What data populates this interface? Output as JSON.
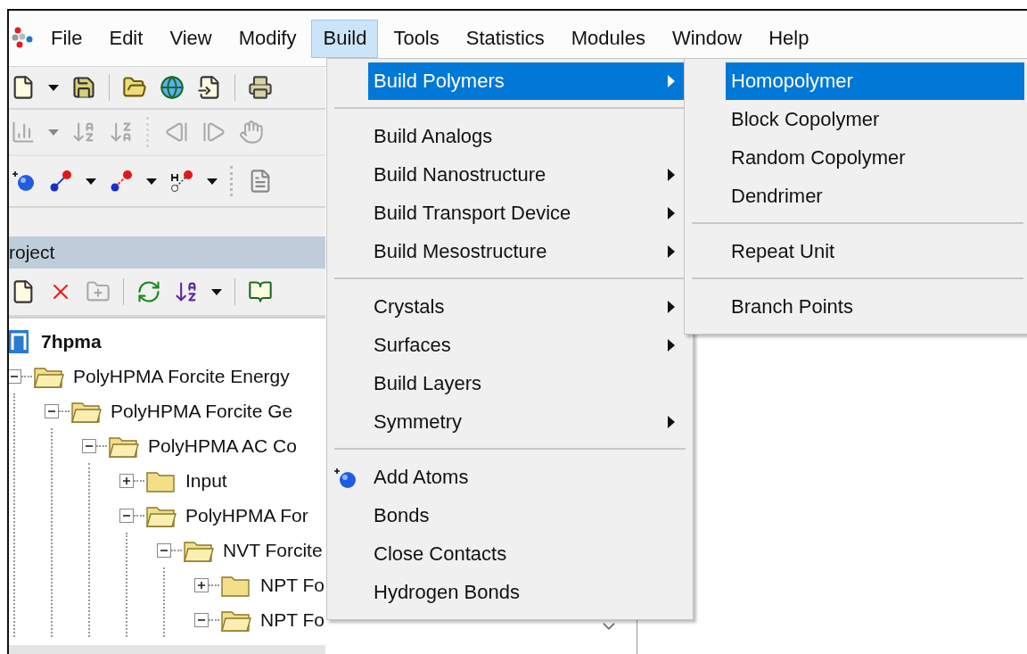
{
  "menu_bar": [
    {
      "label": "File",
      "selected": false
    },
    {
      "label": "Edit",
      "selected": false
    },
    {
      "label": "View",
      "selected": false
    },
    {
      "label": "Modify",
      "selected": false
    },
    {
      "label": "Build",
      "selected": true
    },
    {
      "label": "Tools",
      "selected": false
    },
    {
      "label": "Statistics",
      "selected": false
    },
    {
      "label": "Modules",
      "selected": false
    },
    {
      "label": "Window",
      "selected": false
    },
    {
      "label": "Help",
      "selected": false
    }
  ],
  "toolbars": [
    {
      "disabled": false
    },
    {
      "disabled": true
    },
    {
      "disabled": false
    }
  ],
  "project_panel": {
    "title": "roject",
    "tree": {
      "label": "7hpma",
      "children": [
        {
          "label": "PolyHPMA Forcite Energy",
          "expanded": true,
          "children": [
            {
              "label": "PolyHPMA Forcite Ge",
              "expanded": true,
              "children": [
                {
                  "label": "PolyHPMA AC Co",
                  "expanded": true,
                  "children": [
                    {
                      "label": "Input",
                      "expanded": false
                    },
                    {
                      "label": "PolyHPMA For",
                      "expanded": true,
                      "children": [
                        {
                          "label": "NVT Forcite",
                          "expanded": true,
                          "children": [
                            {
                              "label": "NPT Fo",
                              "expanded": false
                            },
                            {
                              "label": "NPT Fo",
                              "expanded": true
                            }
                          ]
                        }
                      ]
                    }
                  ]
                }
              ]
            }
          ]
        }
      ]
    }
  },
  "build_menu": {
    "items": [
      {
        "kind": "item",
        "label": "Build Polymers",
        "submenu": true,
        "selected": true
      },
      {
        "kind": "separator"
      },
      {
        "kind": "item",
        "label": "Build Analogs",
        "submenu": false,
        "selected": false
      },
      {
        "kind": "item",
        "label": "Build Nanostructure",
        "submenu": true,
        "selected": false
      },
      {
        "kind": "item",
        "label": "Build Transport Device",
        "submenu": true,
        "selected": false
      },
      {
        "kind": "item",
        "label": "Build Mesostructure",
        "submenu": true,
        "selected": false
      },
      {
        "kind": "separator"
      },
      {
        "kind": "item",
        "label": "Crystals",
        "submenu": true,
        "selected": false
      },
      {
        "kind": "item",
        "label": "Surfaces",
        "submenu": true,
        "selected": false
      },
      {
        "kind": "item",
        "label": "Build Layers",
        "submenu": false,
        "selected": false
      },
      {
        "kind": "item",
        "label": "Symmetry",
        "submenu": true,
        "selected": false
      },
      {
        "kind": "separator"
      },
      {
        "kind": "item",
        "label": "Add Atoms",
        "submenu": false,
        "selected": false,
        "has_icon": true
      },
      {
        "kind": "item",
        "label": "Bonds",
        "submenu": false,
        "selected": false
      },
      {
        "kind": "item",
        "label": "Close Contacts",
        "submenu": false,
        "selected": false
      },
      {
        "kind": "item",
        "label": "Hydrogen Bonds",
        "submenu": false,
        "selected": false
      }
    ]
  },
  "polymers_submenu": {
    "items": [
      {
        "kind": "item",
        "label": "Homopolymer",
        "submenu": false,
        "selected": true
      },
      {
        "kind": "item",
        "label": "Block Copolymer",
        "submenu": false,
        "selected": false
      },
      {
        "kind": "item",
        "label": "Random Copolymer",
        "submenu": false,
        "selected": false
      },
      {
        "kind": "item",
        "label": "Dendrimer",
        "submenu": false,
        "selected": false
      },
      {
        "kind": "separator"
      },
      {
        "kind": "item",
        "label": "Repeat Unit",
        "submenu": false,
        "selected": false
      },
      {
        "kind": "separator"
      },
      {
        "kind": "item",
        "label": "Branch Points",
        "submenu": false,
        "selected": false
      }
    ]
  }
}
